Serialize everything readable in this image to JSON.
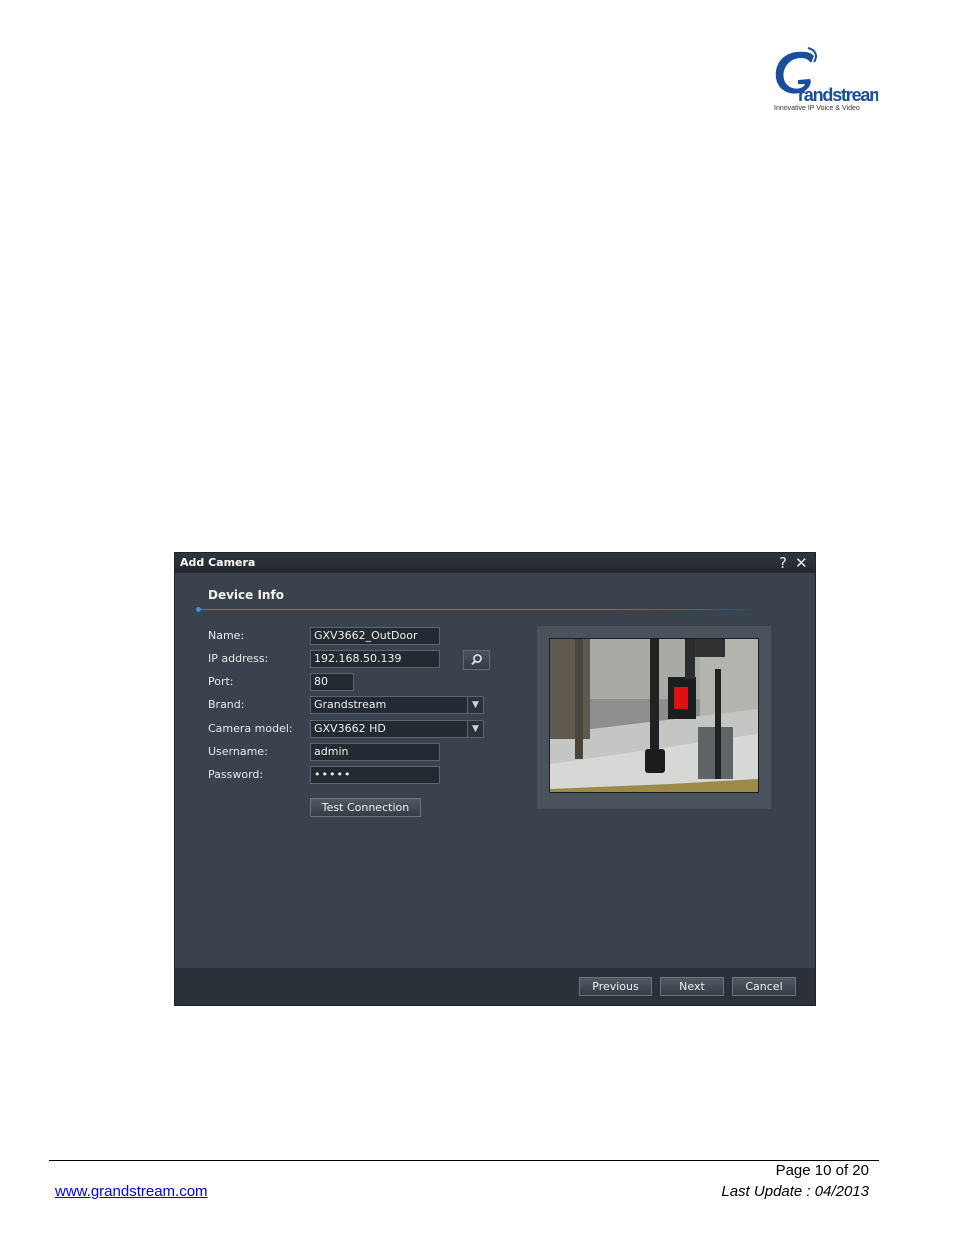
{
  "logo": {
    "wordmark": "Grandstream",
    "tagline": "Innovative IP Voice & Video",
    "color": "#1a4e9c"
  },
  "dialog": {
    "title": "Add Camera",
    "help_label": "?",
    "close_label": "✕",
    "section_title": "Device Info",
    "labels": {
      "name": "Name:",
      "ip": "IP address:",
      "port": "Port:",
      "brand": "Brand:",
      "model": "Camera model:",
      "username": "Username:",
      "password": "Password:"
    },
    "values": {
      "name": "GXV3662_OutDoor",
      "ip": "192.168.50.139",
      "port": "80",
      "brand": "Grandstream",
      "model": "GXV3662 HD",
      "username": "admin",
      "password": "•••••"
    },
    "search_icon": "magnifier-icon",
    "test_button": "Test Connection",
    "buttons": {
      "previous": "Previous",
      "next": "Next",
      "cancel": "Cancel"
    },
    "accent_color": "#2f82d4"
  },
  "page_footer": {
    "page": "Page 10 of 20",
    "url": "www.grandstream.com",
    "last_update": "Last Update : 04/2013"
  }
}
